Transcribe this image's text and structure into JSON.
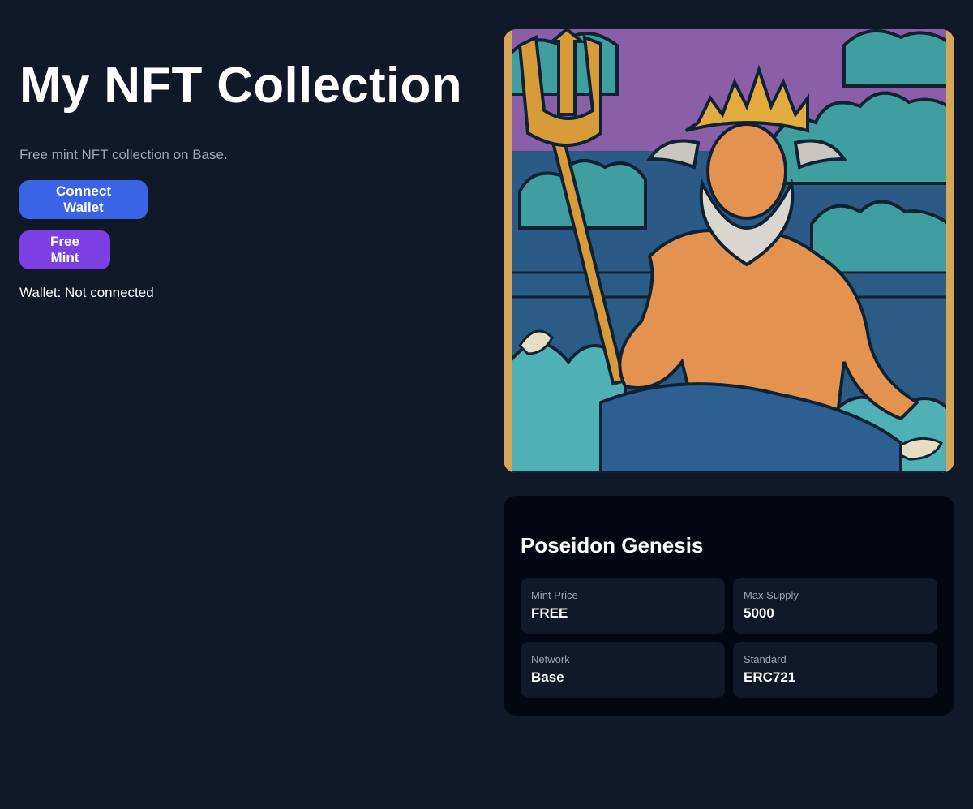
{
  "header": {
    "title": "My NFT Collection",
    "subtitle": "Free mint NFT collection on Base."
  },
  "actions": {
    "connect_label": "Connect Wallet",
    "mint_label": "Free Mint"
  },
  "wallet": {
    "status": "Wallet: Not connected"
  },
  "nft": {
    "image_subject": "poseidon-artwork",
    "name": "Poseidon Genesis",
    "stats": [
      {
        "label": "Mint Price",
        "value": "FREE"
      },
      {
        "label": "Max Supply",
        "value": "5000"
      },
      {
        "label": "Network",
        "value": "Base"
      },
      {
        "label": "Standard",
        "value": "ERC721"
      }
    ]
  },
  "colors": {
    "background": "#111827",
    "card": "#030712",
    "stat_box": "#111827",
    "connect_button": "#3b63e6",
    "mint_button": "#7b3fe4",
    "muted_text": "#9ca3af"
  }
}
